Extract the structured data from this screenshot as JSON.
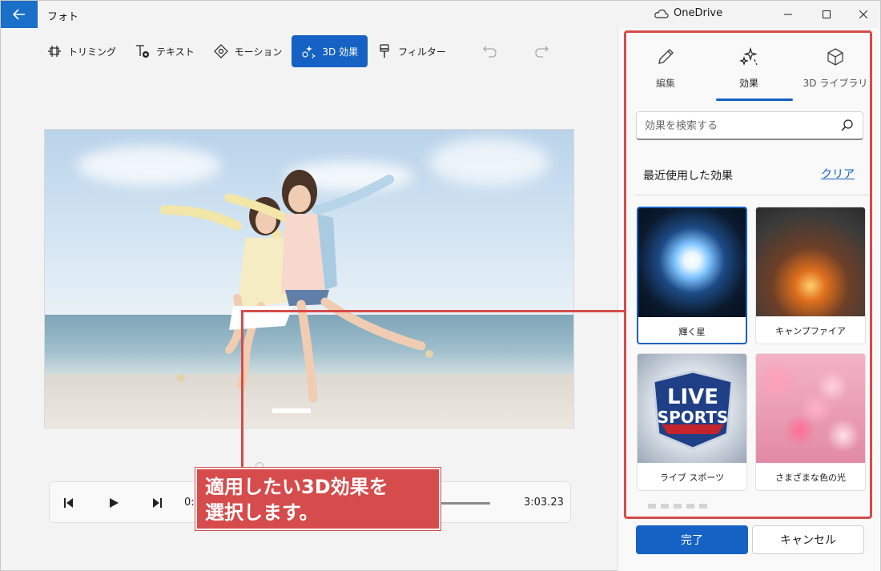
{
  "window": {
    "title": "フォト",
    "cloud_label": "OneDrive"
  },
  "toolbar": {
    "trim": "トリミング",
    "text": "テキスト",
    "motion": "モーション",
    "effects3d": "3D 効果",
    "filter": "フィルター"
  },
  "playback": {
    "current_time": "0:",
    "total_time": "3:03.23"
  },
  "panel": {
    "tabs": [
      {
        "label": "編集",
        "icon": "pencil-icon"
      },
      {
        "label": "効果",
        "icon": "sparkle-icon"
      },
      {
        "label": "3D ライブラリ",
        "icon": "cube-icon"
      }
    ],
    "selected_tab": "効果",
    "search_placeholder": "効果を検索する",
    "section_title": "最近使用した効果",
    "clear_label": "クリア",
    "effects": [
      {
        "label": "輝く星"
      },
      {
        "label": "キャンプファイア"
      },
      {
        "label": "ライブ スポーツ"
      },
      {
        "label": "さまざまな色の光"
      }
    ],
    "selected_effect": "輝く星",
    "done_label": "完了",
    "cancel_label": "キャンセル"
  },
  "sports_thumb": {
    "line1": "LIVE",
    "line2": "SPORTS"
  },
  "callout": {
    "line1": "適用したい3D効果を",
    "line2": "選択します。"
  },
  "colors": {
    "accent": "#1662c4",
    "highlight": "#d64b4b"
  }
}
